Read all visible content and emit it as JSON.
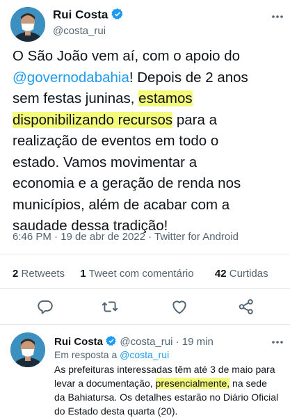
{
  "main_tweet": {
    "author_name": "Rui Costa",
    "author_handle": "@costa_rui",
    "text": {
      "l1": "O São João vem aí, com o apoio do",
      "l2_link": "@governodabahia",
      "l2_rest": "!  Depois de 2 anos",
      "l3_pre": "sem festas juninas, ",
      "l3_hl": "estamos",
      "l4_hl": "disponibilizando recursos",
      "l4_rest": " para a",
      "l5": "realização de eventos em todo o",
      "l6": "estado. Vamos movimentar a",
      "l7": "economia e a geração de renda nos",
      "l8": "municípios, além de acabar com a",
      "l9": "saudade dessa tradição!"
    },
    "meta": "6:46 PM · 19 de abr de 2022 · Twitter for Android",
    "stats": {
      "retweets_count": "2",
      "retweets_label": "Retweets",
      "quotes_count": "1",
      "quotes_label": "Tweet com comentário",
      "likes_count": "42",
      "likes_label": "Curtidas"
    }
  },
  "reply_tweet": {
    "author_name": "Rui Costa",
    "author_handle": "@costa_rui",
    "time": "· 19 min",
    "reply_prefix": "Em resposta a",
    "reply_handle": "@costa_rui",
    "text": {
      "l1": "As prefeituras interessadas têm até 3 de maio para",
      "l2_pre": "levar a documentação, ",
      "l2_hl": "presencialmente,",
      "l2_rest": " na sede",
      "l3": "da Bahiatursa. Os detalhes estarão no Diário Oficial",
      "l4": "do Estado desta quarta (20)."
    }
  },
  "colors": {
    "accent": "#1d9bf0",
    "highlight": "#f4fa7a",
    "muted_text": "#536471"
  },
  "icons": [
    "verified-badge-icon",
    "more-icon",
    "reply-icon",
    "retweet-icon",
    "like-icon",
    "share-icon"
  ]
}
